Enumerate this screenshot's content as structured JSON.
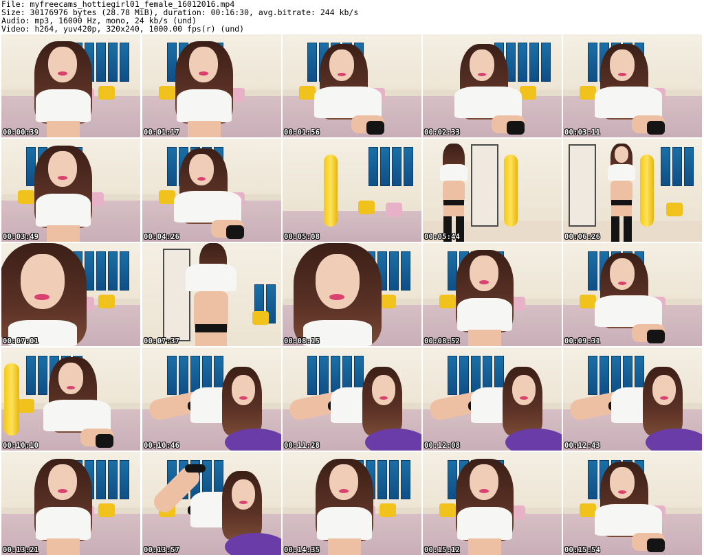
{
  "header": {
    "line1": "File: myfreecams_hottiegirl01_female_16012016.mp4",
    "line2": "Size: 30176976 bytes (28.78 MiB), duration: 00:16:30, avg.bitrate: 244 kb/s",
    "line3": "Audio: mp3, 16000 Hz, mono, 24 kb/s (und)",
    "line4": "Video: h264, yuv420p, 320x240, 1000.00 fps(r) (und)"
  },
  "thumbnails": [
    {
      "timestamp": "00:00:39",
      "scene": "bed-close"
    },
    {
      "timestamp": "00:01:17",
      "scene": "bed-close"
    },
    {
      "timestamp": "00:01:56",
      "scene": "bed-lean"
    },
    {
      "timestamp": "00:02:33",
      "scene": "bed-lean"
    },
    {
      "timestamp": "00:03:11",
      "scene": "bed-lean"
    },
    {
      "timestamp": "00:03:49",
      "scene": "bed-close"
    },
    {
      "timestamp": "00:04:26",
      "scene": "bed-lean"
    },
    {
      "timestamp": "00:05:08",
      "scene": "empty-room"
    },
    {
      "timestamp": "00:05:44",
      "scene": "standing-back"
    },
    {
      "timestamp": "00:06:26",
      "scene": "standing-front"
    },
    {
      "timestamp": "00:07:01",
      "scene": "face-close"
    },
    {
      "timestamp": "00:07:37",
      "scene": "standing-torso"
    },
    {
      "timestamp": "00:08:15",
      "scene": "face-close"
    },
    {
      "timestamp": "00:08:52",
      "scene": "bed-close"
    },
    {
      "timestamp": "00:09:31",
      "scene": "bed-lean"
    },
    {
      "timestamp": "00:10:10",
      "scene": "bed-lean-lamp"
    },
    {
      "timestamp": "00:10:46",
      "scene": "lying"
    },
    {
      "timestamp": "00:11:28",
      "scene": "lying"
    },
    {
      "timestamp": "00:12:08",
      "scene": "lying"
    },
    {
      "timestamp": "00:12:43",
      "scene": "lying"
    },
    {
      "timestamp": "00:13:21",
      "scene": "bed-close"
    },
    {
      "timestamp": "00:13:57",
      "scene": "lying-legs-up"
    },
    {
      "timestamp": "00:14:35",
      "scene": "bed-close"
    },
    {
      "timestamp": "00:15:12",
      "scene": "bed-close"
    },
    {
      "timestamp": "00:15:54",
      "scene": "bed-lean"
    }
  ],
  "colors": {
    "background": "#ffffff",
    "header_text": "#000000",
    "timestamp_text": "#ffffff",
    "wall_panel": "#1a6fa6",
    "pillow_yellow": "#f1c11c",
    "bedding": "#d6bfc4",
    "top_white": "#f6f6f4",
    "hair": "#3b1f17"
  }
}
